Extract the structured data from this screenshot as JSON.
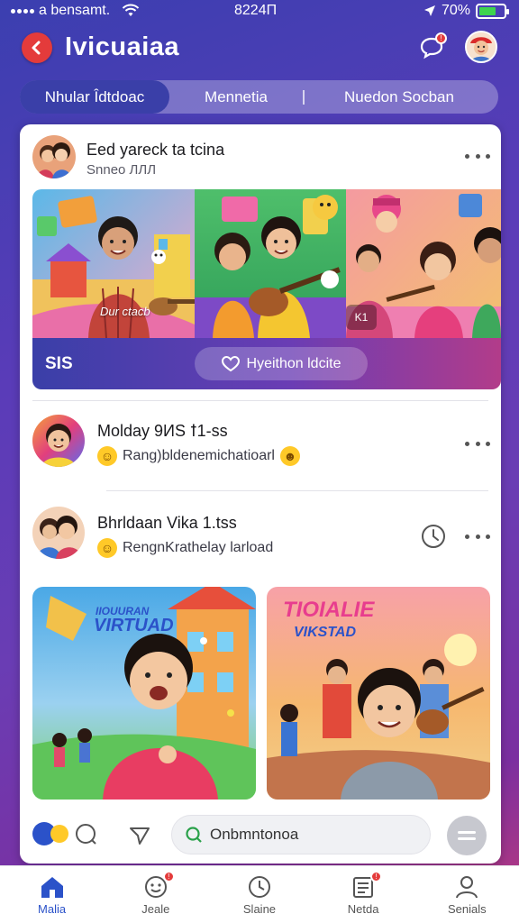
{
  "status_bar": {
    "carrier": "a bensamt.",
    "time": "8224П",
    "battery": "70%"
  },
  "header": {
    "title": "Ivicuaiaa",
    "chat_badge": "!"
  },
  "tabs": [
    {
      "label": "Nhular Îdtdoac",
      "active": true
    },
    {
      "label": "Mennetia",
      "active": false
    },
    {
      "label": "Nuedon Socban",
      "active": false
    }
  ],
  "post": {
    "title": "Eed yareck ta tcina",
    "subtitle": "Snneo ЛЛЛ",
    "panel_caption": "Dur ctacb",
    "media_count": "SIS",
    "action_button": "Hyeithon ldcite",
    "play_label": "K1"
  },
  "rows": [
    {
      "title": "Molday 9ИS ꝉ1-ss",
      "subtitle": "Rang)bldenemichatioarl"
    },
    {
      "title": "Bhrldaan Vika 1.tss",
      "subtitle": "RengnKrathelay larload"
    }
  ],
  "thumbnails": [
    {
      "title_top": "IIOUURAN",
      "title": "VIRTUAD"
    },
    {
      "title_top": "TIOIALIE",
      "title": "VIKSTAD"
    }
  ],
  "comment": {
    "placeholder": "Onbmntonoa"
  },
  "nav": [
    {
      "label": "Malia",
      "active": true,
      "badge": false
    },
    {
      "label": "Jeale",
      "active": false,
      "badge": true
    },
    {
      "label": "Slaine",
      "active": false,
      "badge": false
    },
    {
      "label": "Netda",
      "active": false,
      "badge": true
    },
    {
      "label": "Senials",
      "active": false,
      "badge": false
    }
  ],
  "colors": {
    "accent": "#3a3fa8",
    "badge": "#e43b3b",
    "active_nav": "#2b52c9"
  }
}
